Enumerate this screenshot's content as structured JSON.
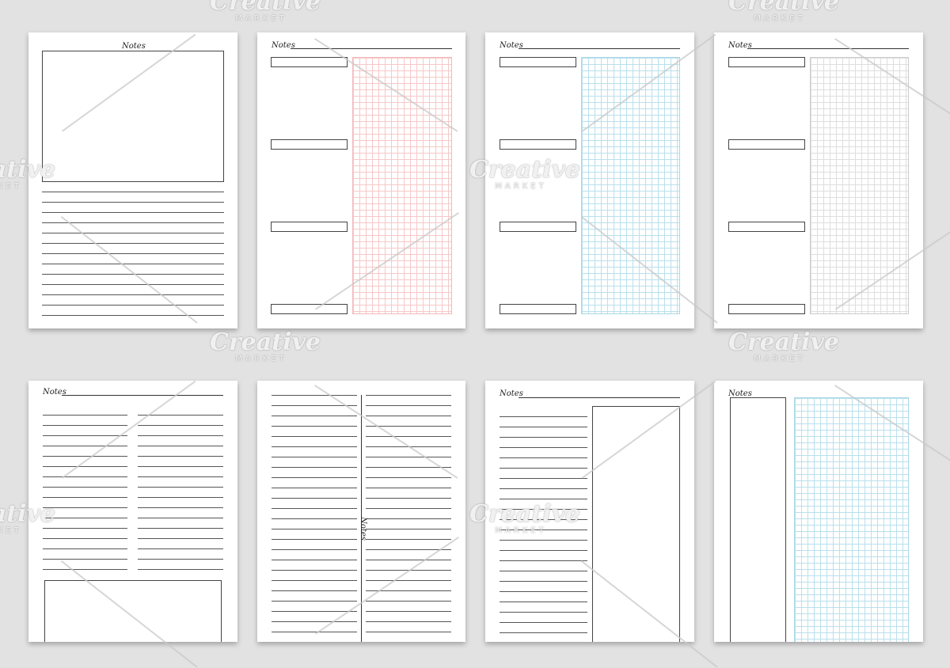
{
  "notes_label": "Notes",
  "watermark": {
    "brand": "Creative",
    "sub": "MARKET"
  },
  "colors": {
    "pink_grid": "#f7c8c8",
    "blue_grid": "#b9e0ec",
    "gray_grid": "#dedede",
    "background": "#e2e2e2"
  }
}
